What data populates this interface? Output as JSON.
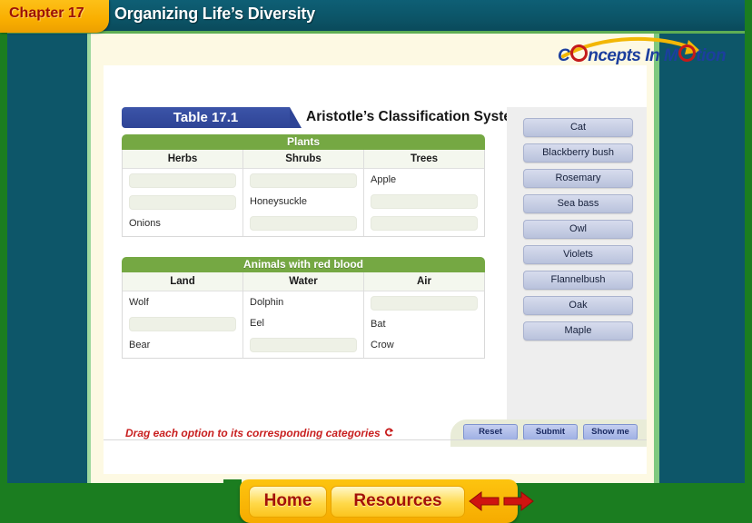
{
  "header": {
    "chapter_label": "Chapter 17",
    "title": "Organizing Life’s Diversity",
    "logo": {
      "part1": "C",
      "part2": "ncepts In M",
      "part3": "tion",
      "name": "concepts-in-motion-logo"
    }
  },
  "table": {
    "number_label": "Table 17.1",
    "title": "Aristotle’s Classification System",
    "sections": [
      {
        "banner": "Plants",
        "columns": [
          {
            "header": "Herbs",
            "cells": [
              {
                "text": "",
                "empty": true
              },
              {
                "text": "",
                "empty": true
              },
              {
                "text": "Onions",
                "empty": false
              }
            ]
          },
          {
            "header": "Shrubs",
            "cells": [
              {
                "text": "",
                "empty": true
              },
              {
                "text": "Honeysuckle",
                "empty": false
              },
              {
                "text": "",
                "empty": true
              }
            ]
          },
          {
            "header": "Trees",
            "cells": [
              {
                "text": "Apple",
                "empty": false
              },
              {
                "text": "",
                "empty": true
              },
              {
                "text": "",
                "empty": true
              }
            ]
          }
        ]
      },
      {
        "banner": "Animals with red blood",
        "columns": [
          {
            "header": "Land",
            "cells": [
              {
                "text": "Wolf",
                "empty": false
              },
              {
                "text": "",
                "empty": true
              },
              {
                "text": "Bear",
                "empty": false
              }
            ]
          },
          {
            "header": "Water",
            "cells": [
              {
                "text": "Dolphin",
                "empty": false
              },
              {
                "text": "Eel",
                "empty": false
              },
              {
                "text": "",
                "empty": true
              }
            ]
          },
          {
            "header": "Air",
            "cells": [
              {
                "text": "",
                "empty": true
              },
              {
                "text": "Bat",
                "empty": false
              },
              {
                "text": "Crow",
                "empty": false
              }
            ]
          }
        ]
      }
    ]
  },
  "options": [
    "Cat",
    "Blackberry bush",
    "Rosemary",
    "Sea bass",
    "Owl",
    "Violets",
    "Flannelbush",
    "Oak",
    "Maple"
  ],
  "footer": {
    "instruction": "Drag each option to its corresponding categories",
    "replay_icon": "replay-arrow-icon",
    "buttons": [
      {
        "label": "Reset",
        "name": "reset-button"
      },
      {
        "label": "Submit",
        "name": "submit-button"
      },
      {
        "label": "Show me",
        "name": "show-me-button"
      }
    ]
  },
  "navbar": {
    "home": "Home",
    "resources": "Resources",
    "prev_icon": "left-arrow-icon",
    "next_icon": "right-arrow-icon"
  },
  "colors": {
    "frame_green": "#1b7d20",
    "header_teal": "#0c5568",
    "chapter_gold": "#f9ae00",
    "chapter_text_red": "#9c1006",
    "table_banner_blue": "#2e4496",
    "section_green": "#75a843",
    "option_blue": "#b9c2dc",
    "instruction_red": "#c81f1f",
    "nav_gold": "#f6ab00",
    "page_cream": "#fdf9e3"
  }
}
